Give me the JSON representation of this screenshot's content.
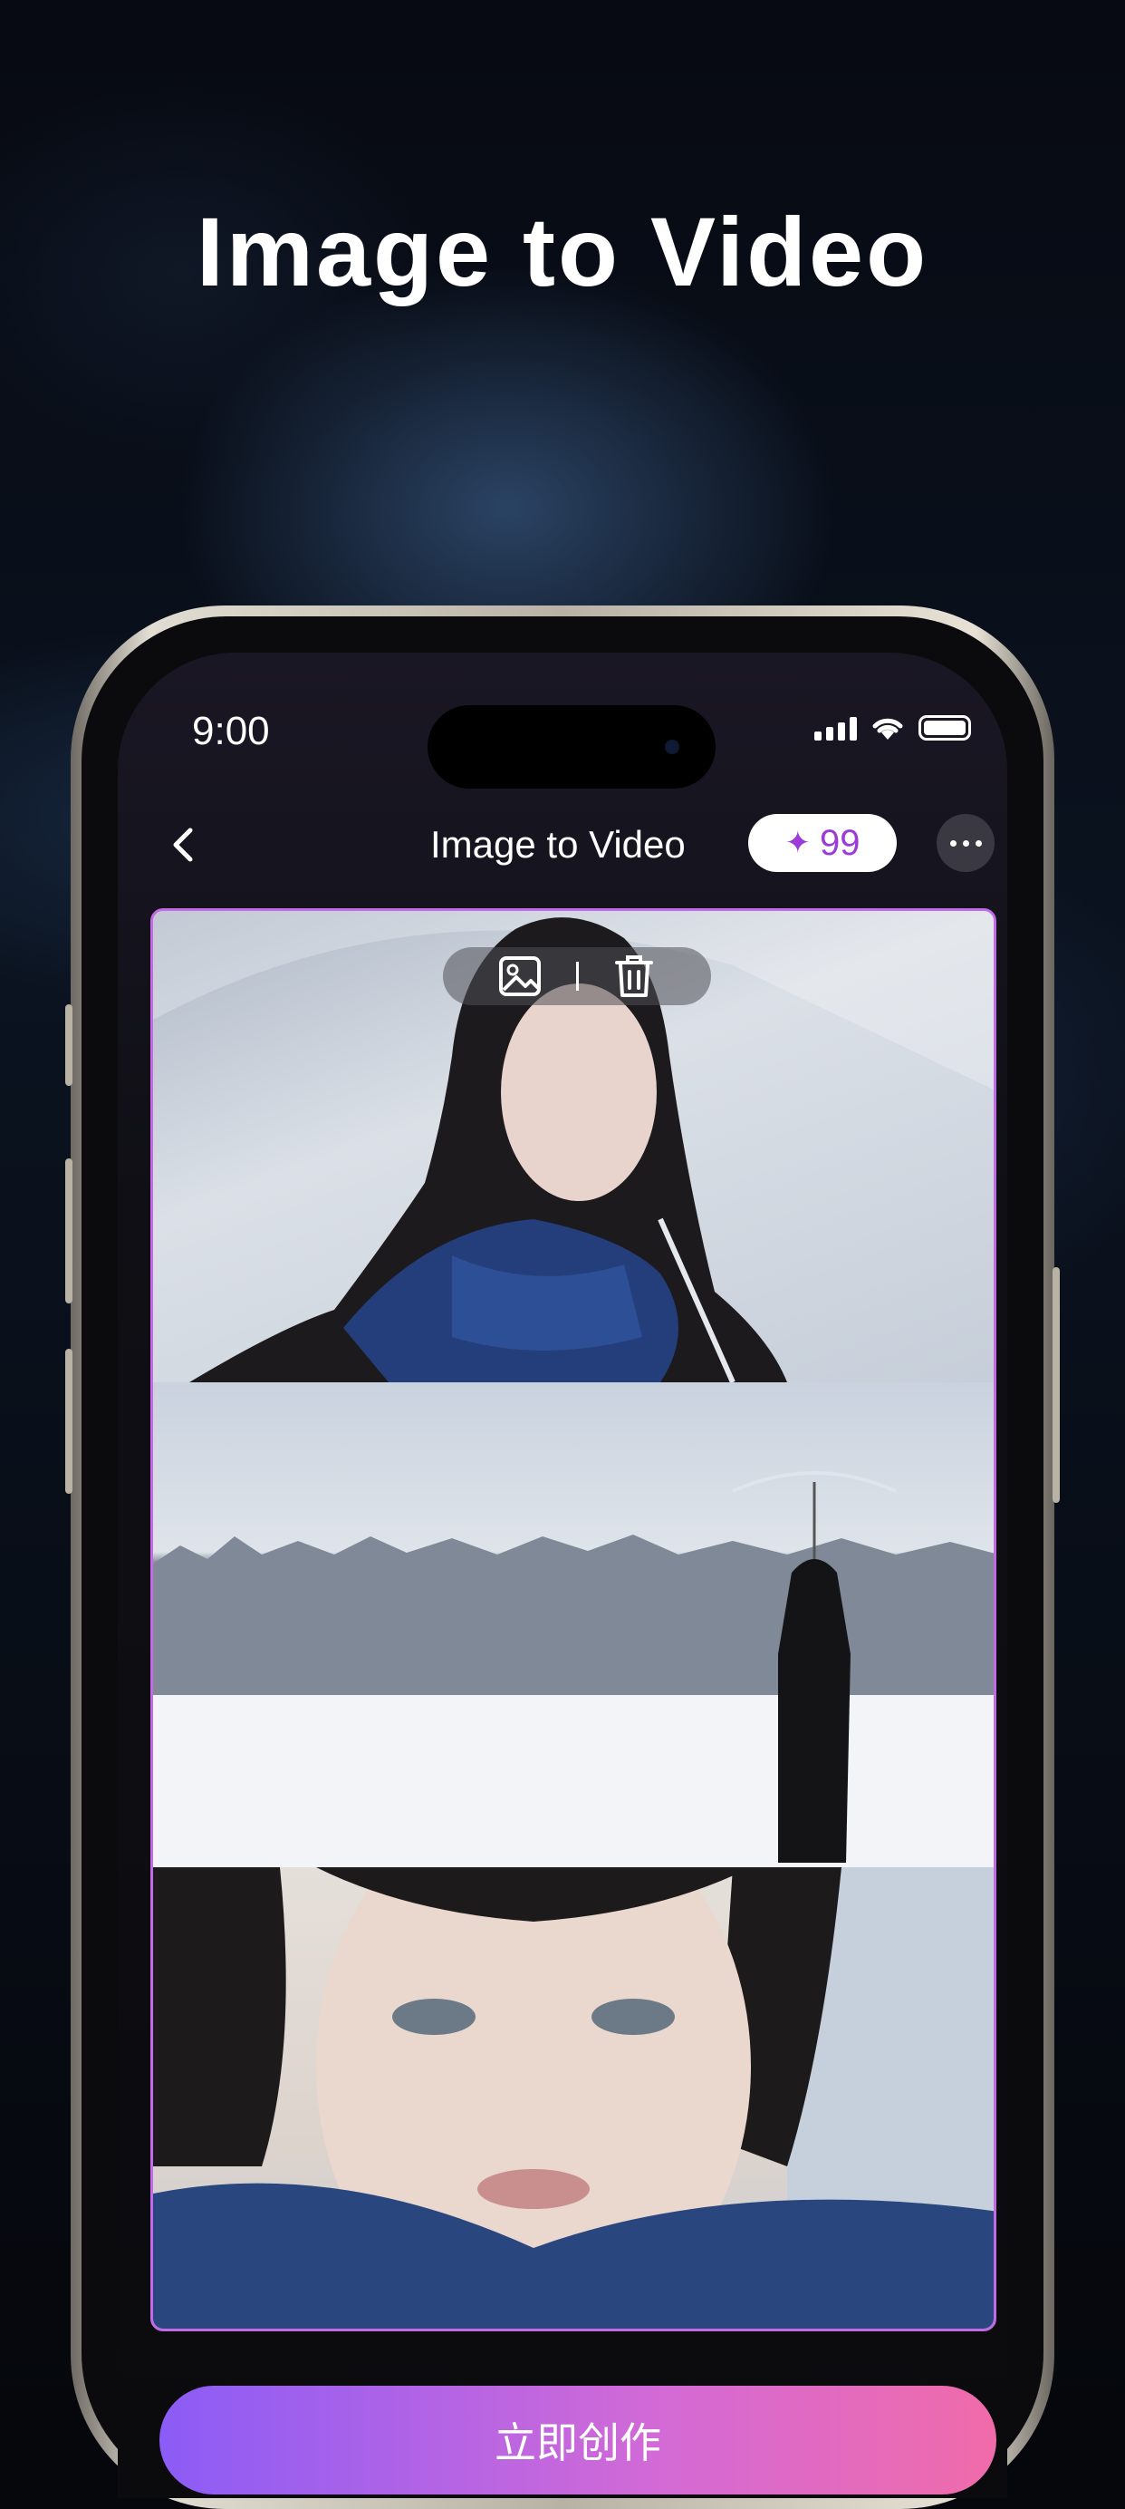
{
  "promo": {
    "title": "Image to Video"
  },
  "status_bar": {
    "time": "9:00"
  },
  "nav": {
    "title": "Image to Video",
    "credits": "99",
    "credit_icon": "sparkle-icon"
  },
  "canvas": {
    "toolbar": {
      "icons": [
        "replace-image-icon",
        "trash-icon"
      ]
    },
    "images": [
      "woman-with-umbrella-portrait",
      "woman-in-snow-field",
      "woman-closeup-snow"
    ]
  },
  "cta": {
    "label": "立即创作"
  },
  "colors": {
    "accent": "#9d3bd8",
    "border": "#c36ae6",
    "cta_start": "#8b5cf6",
    "cta_end": "#f06ba9"
  }
}
